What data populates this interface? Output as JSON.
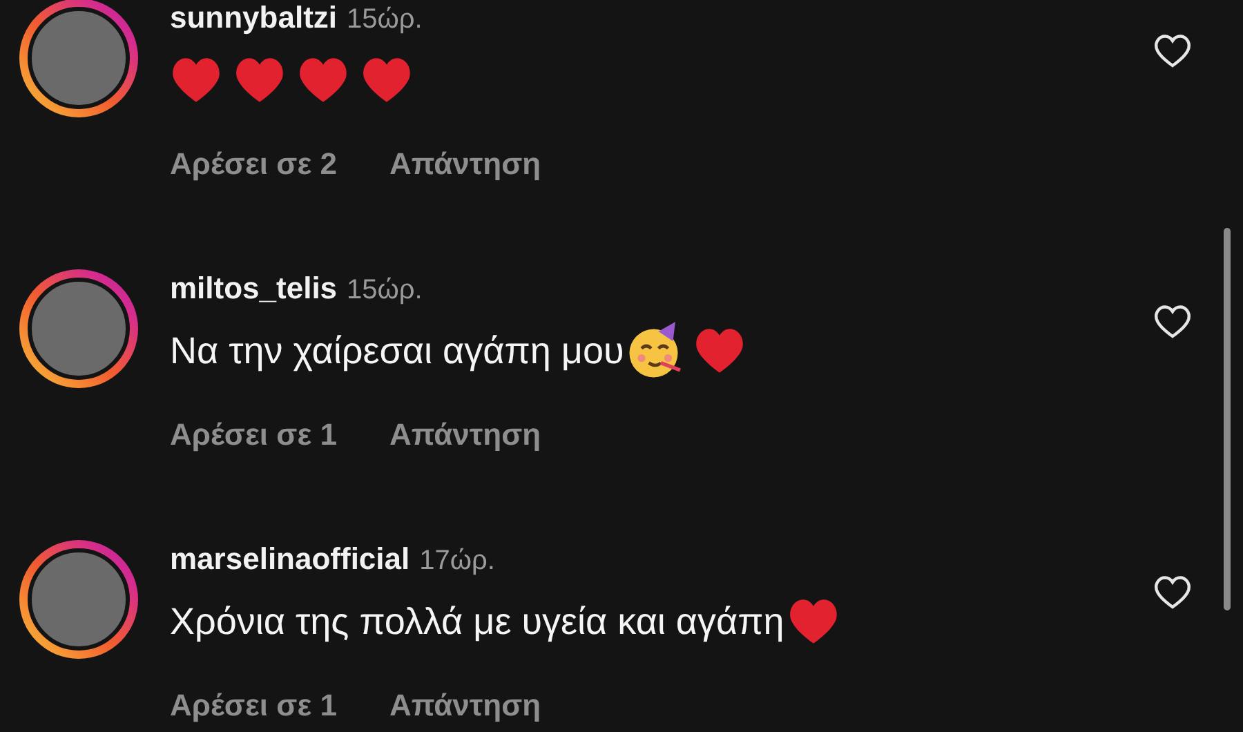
{
  "comments": [
    {
      "username": "sunnybaltzi",
      "time": "15ώρ.",
      "emoji": [
        {
          "kind": "heart"
        },
        {
          "kind": "heart"
        },
        {
          "kind": "heart"
        },
        {
          "kind": "heart"
        }
      ],
      "likes": "Αρέσει σε 2",
      "reply": "Απάντηση",
      "liked": false
    },
    {
      "username": "miltos_telis",
      "time": "15ώρ.",
      "text": "Να την χαίρεσαι αγάπη μου",
      "emoji": [
        {
          "kind": "party-face"
        },
        {
          "kind": "heart"
        }
      ],
      "likes": "Αρέσει σε 1",
      "reply": "Απάντηση",
      "liked": false
    },
    {
      "username": "marselinaofficial",
      "time": "17ώρ.",
      "text": "Χρόνια της πολλά με υγεία και αγάπη",
      "emoji": [
        {
          "kind": "heart"
        }
      ],
      "likes": "Αρέσει σε 1",
      "reply": "Απάντηση",
      "liked": false
    }
  ]
}
